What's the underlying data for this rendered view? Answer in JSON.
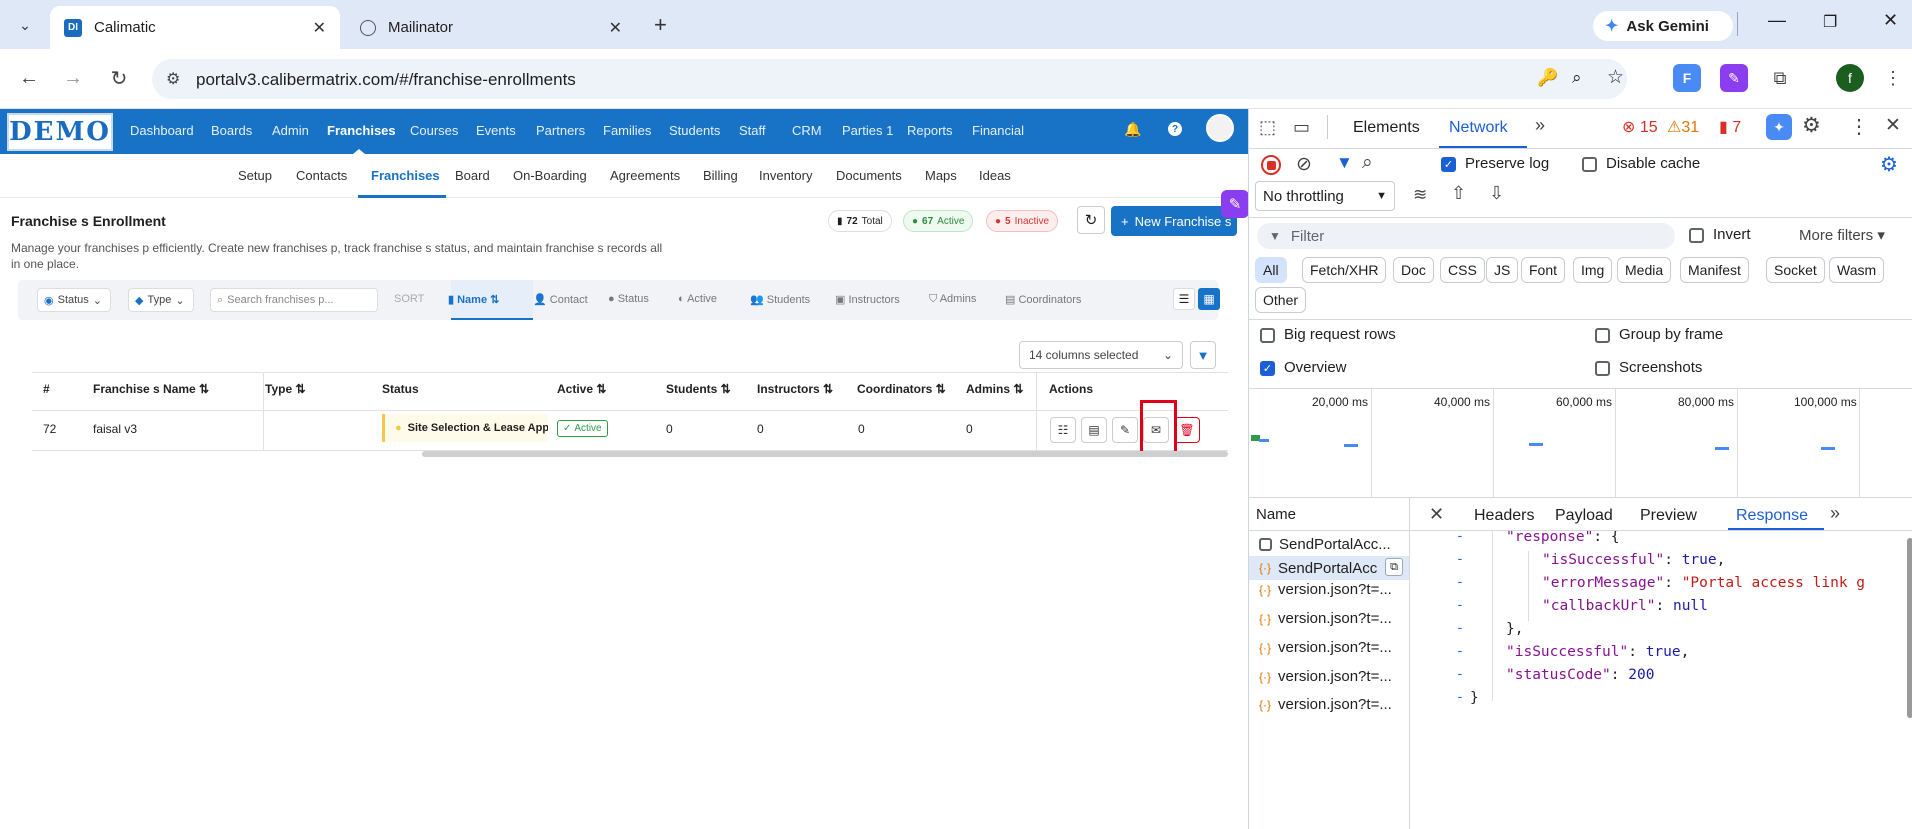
{
  "browser": {
    "tabs": [
      {
        "title": "Calimatic",
        "favicon": "DI"
      },
      {
        "title": "Mailinator",
        "favicon": "globe-icon"
      }
    ],
    "gemini_label": "Ask Gemini",
    "url": "portalv3.calibermatrix.com/#/franchise-enrollments",
    "profile_initial": "f"
  },
  "app": {
    "logo_text": "DEMO",
    "top_nav": [
      "Dashboard",
      "Boards",
      "Admin",
      "Franchises",
      "Courses",
      "Events",
      "Partners",
      "Families",
      "Students",
      "Staff",
      "CRM",
      "Parties 1",
      "Reports",
      "Financial"
    ],
    "sub_nav": [
      "Setup",
      "Contacts",
      "Franchises",
      "Board",
      "On-Boarding",
      "Agreements",
      "Billing",
      "Inventory",
      "Documents",
      "Maps",
      "Ideas"
    ],
    "page_title": "Franchise s Enrollment",
    "page_desc": "Manage your franchises p efficiently. Create new franchises p, track franchise s status, and maintain franchise s records all in one place.",
    "stats": {
      "total_num": "72",
      "total_label": "Total",
      "active_num": "67",
      "active_label": "Active",
      "inactive_num": "5",
      "inactive_label": "Inactive"
    },
    "new_button": "New Franchise s",
    "filters": {
      "status": "Status",
      "type": "Type",
      "search_placeholder": "Search franchises p..."
    },
    "sort": {
      "label": "SORT",
      "items": [
        "Name",
        "Contact",
        "Status",
        "Active",
        "Students",
        "Instructors",
        "Admins",
        "Coordinators"
      ]
    },
    "columns_selected": "14 columns selected",
    "table": {
      "headers": [
        "#",
        "Franchise s Name",
        "Type",
        "Status",
        "Active",
        "Students",
        "Instructors",
        "Coordinators",
        "Admins",
        "Actions"
      ],
      "row": {
        "num": "72",
        "name": "faisal v3",
        "type": "",
        "status": "Site Selection & Lease App",
        "active": "Active",
        "students": "0",
        "instructors": "0",
        "coordinators": "0",
        "admins": "0"
      }
    }
  },
  "devtools": {
    "tabs": [
      "Elements",
      "Network"
    ],
    "errors": "15",
    "warnings": "31",
    "issues": "7",
    "preserve_log": "Preserve log",
    "disable_cache": "Disable cache",
    "throttling": "No throttling",
    "filter_placeholder": "Filter",
    "invert": "Invert",
    "more_filters": "More filters",
    "chips": [
      "All",
      "Fetch/XHR",
      "Doc",
      "CSS",
      "JS",
      "Font",
      "Img",
      "Media",
      "Manifest",
      "Socket",
      "Wasm",
      "Other"
    ],
    "options": {
      "big_request_rows": "Big request rows",
      "group_by_frame": "Group by frame",
      "overview": "Overview",
      "screenshots": "Screenshots"
    },
    "timeline_ticks": [
      "20,000 ms",
      "40,000 ms",
      "60,000 ms",
      "80,000 ms",
      "100,000 ms"
    ],
    "name_header": "Name",
    "requests": [
      "SendPortalAcc...",
      "SendPortalAcc",
      "version.json?t=...",
      "version.json?t=...",
      "version.json?t=...",
      "version.json?t=...",
      "version.json?t=..."
    ],
    "detail_tabs": [
      "Headers",
      "Payload",
      "Preview",
      "Response"
    ],
    "response": {
      "l1_key": "\"response\"",
      "l2_key": "\"isSuccessful\"",
      "l2_val": "true",
      "l3_key": "\"errorMessage\"",
      "l3_val": "\"Portal access link g",
      "l4_key": "\"callbackUrl\"",
      "l4_val": "null",
      "l6_key": "\"isSuccessful\"",
      "l6_val": "true",
      "l7_key": "\"statusCode\"",
      "l7_val": "200"
    }
  }
}
